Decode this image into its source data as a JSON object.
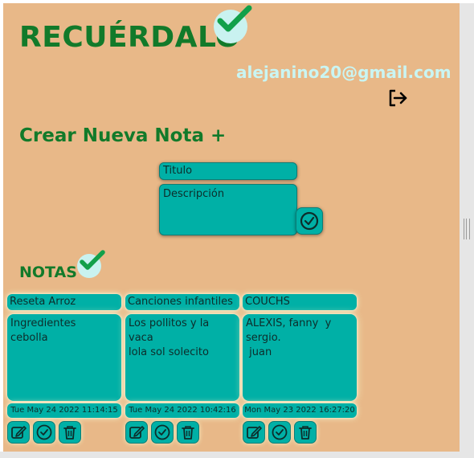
{
  "header": {
    "app_title": "RECUÉRDALO",
    "user_email": "alejanino20@gmail.com"
  },
  "create": {
    "section_title": "Crear Nueva Nota +",
    "title_placeholder": "Titulo",
    "description_placeholder": "Descripción"
  },
  "notes": {
    "section_title": "NOTAS",
    "items": [
      {
        "title": "Reseta Arroz",
        "description": "Ingredientes\ncebolla",
        "date": "Tue May 24 2022 11:14:15"
      },
      {
        "title": "Canciones infantiles",
        "description": "Los pollitos y la vaca\nlola sol solecito",
        "date": "Tue May 24 2022 10:42:16"
      },
      {
        "title": "COUCHS",
        "description": "ALEXIS, fanny  y\nsergio.\n juan",
        "date": "Mon May 23 2022 16:27:20"
      }
    ]
  },
  "icons": {
    "title_check": "check-icon",
    "logout": "logout-icon",
    "submit": "check-circle-icon",
    "edit": "edit-icon",
    "done": "check-circle-icon",
    "delete": "trash-icon"
  },
  "colors": {
    "background": "#e8b888",
    "accent_green": "#127a2a",
    "teal": "#00b0a6",
    "email": "#c9f5f3",
    "check_badge": "#c9f2f0"
  }
}
